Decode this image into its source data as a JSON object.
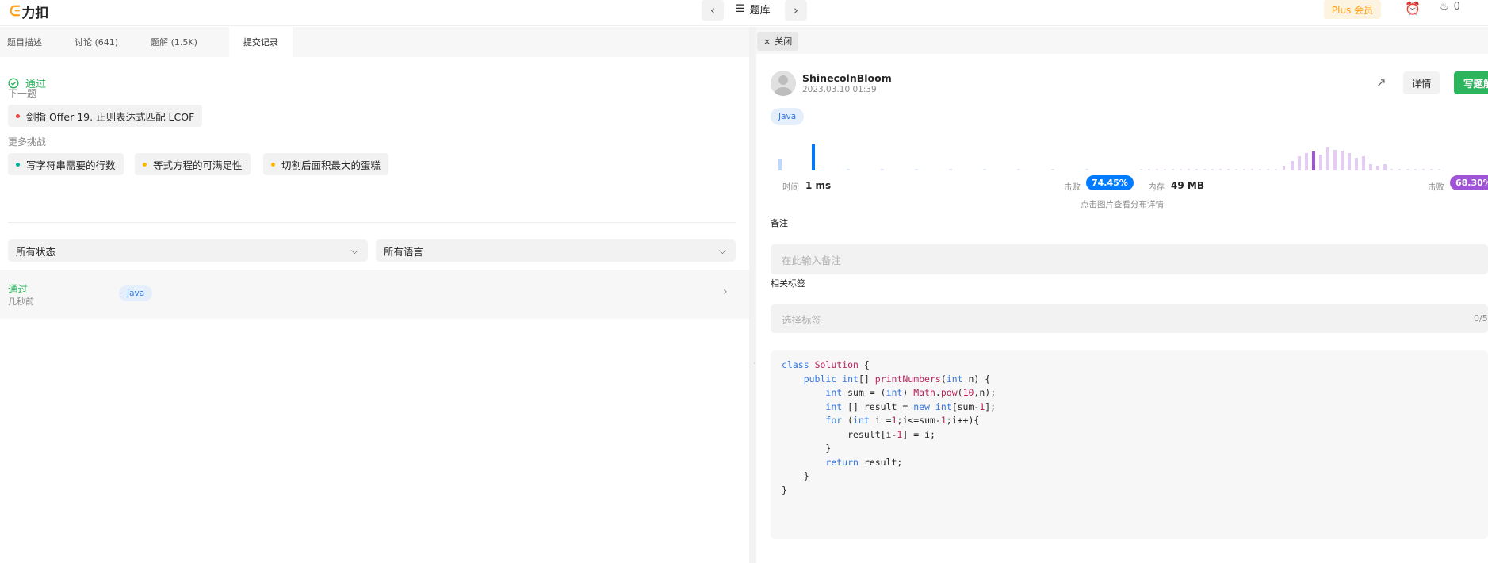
{
  "header": {
    "logo_text": "力扣",
    "problem_list_label": "题库",
    "plus_label": "Plus 会员",
    "fire_count": "0"
  },
  "left": {
    "tabs": [
      {
        "label": "题目描述"
      },
      {
        "label": "讨论 (641)"
      },
      {
        "label": "题解 (1.5K)"
      },
      {
        "label": "提交记录"
      }
    ],
    "status_text": "通过",
    "next_label": "下一题",
    "next_problem": "剑指 Offer 19. 正则表达式匹配 LCOF",
    "more_label": "更多挑战",
    "challenges": [
      {
        "label": "写字符串需要的行数",
        "color": "#00af9b"
      },
      {
        "label": "等式方程的可满足性",
        "color": "#ffb800"
      },
      {
        "label": "切割后面积最大的蛋糕",
        "color": "#ffb800"
      }
    ],
    "filter_status": "所有状态",
    "filter_lang": "所有语言",
    "submission": {
      "status": "通过",
      "time": "几秒前",
      "lang": "Java"
    }
  },
  "right": {
    "close_label": "关闭",
    "user_name": "ShinecolnBloom",
    "submit_date": "2023.03.10 01:39",
    "detail_label": "详情",
    "write_label": "写题解",
    "lang_chip": "Java",
    "runtime_label": "时间",
    "runtime_value": "1 ms",
    "beat_label": "击败",
    "runtime_beat": "74.45%",
    "memory_label": "内存",
    "memory_value": "49 MB",
    "memory_beat": "68.30%",
    "chart_hint": "点击图片查看分布详情",
    "note_label": "备注",
    "note_placeholder": "在此输入备注",
    "tags_label": "相关标签",
    "tags_placeholder": "选择标签",
    "tags_count": "0/5",
    "colors": {
      "accent_green": "#2db55d",
      "runtime_blue": "#007aff",
      "memory_purple": "#9f53d6"
    }
  }
}
